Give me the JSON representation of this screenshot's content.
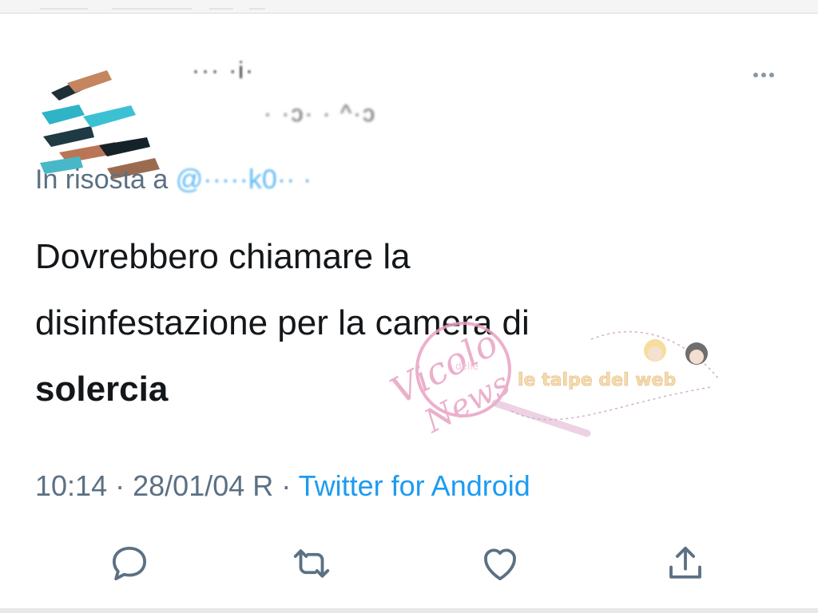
{
  "header": {
    "author_name": "··· ·i·",
    "author_handle": "· ·ɔ· · ^·ɔ"
  },
  "tweet": {
    "reply_prefix": "In ris",
    "reply_mid": "osta a",
    "reply_handle": "@·····k0·· ·"
  },
  "body": {
    "line1": "Dovrebbero chiamare la",
    "line2": "disinfestazione per la camera di",
    "line3": "solercia"
  },
  "meta": {
    "time": "10:14",
    "separator": "·",
    "date": "28/01/04 R",
    "source": "Twitter for Android"
  },
  "actions": {
    "reply_icon": "reply-icon",
    "retweet_icon": "retweet-icon",
    "like_icon": "heart-icon",
    "share_icon": "share-icon"
  },
  "watermark": {
    "main": "Vicolo",
    "small": "delle",
    "sub": "News",
    "banner": "le talpe del web"
  },
  "colors": {
    "text": "#14171a",
    "secondary": "#5b7083",
    "link": "#1d9bf0",
    "icon": "#5b7083"
  }
}
